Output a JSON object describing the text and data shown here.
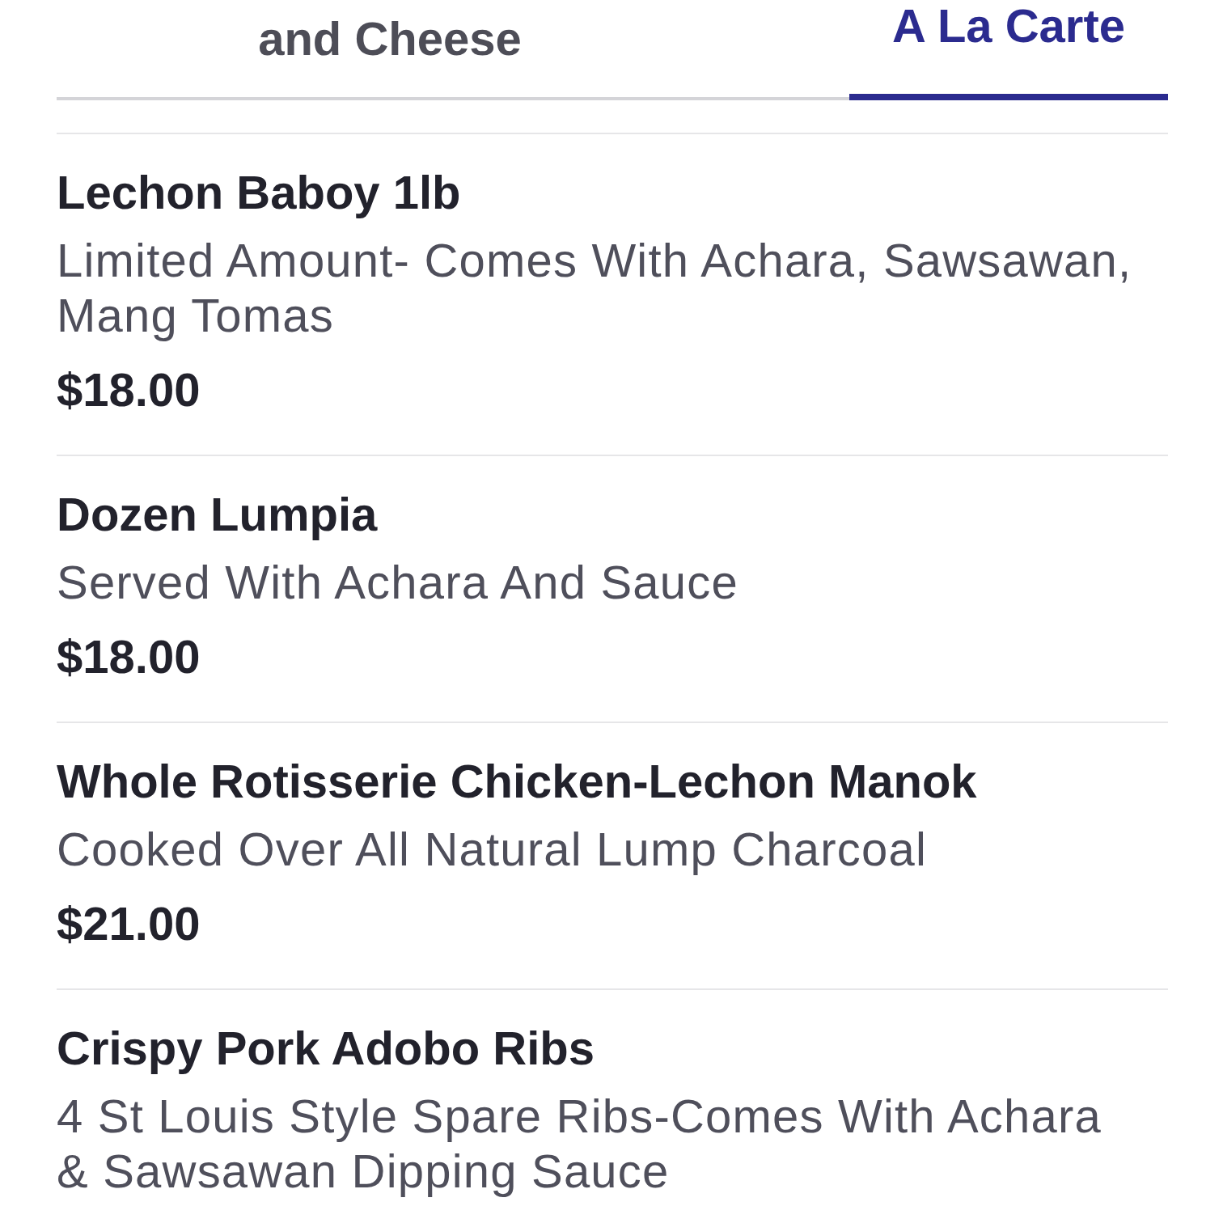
{
  "tabs": [
    {
      "label": "and Cheese",
      "selected": false
    },
    {
      "label": "A La Carte",
      "selected": true
    }
  ],
  "items": [
    {
      "name": "Lechon Baboy 1lb",
      "description": "Limited Amount- Comes With Achara, Sawsawan, Mang Tomas",
      "price": "$18.00"
    },
    {
      "name": "Dozen Lumpia",
      "description": "Served With Achara And Sauce",
      "price": "$18.00"
    },
    {
      "name": "Whole Rotisserie Chicken-Lechon Manok",
      "description": "Cooked Over All Natural Lump Charcoal",
      "price": "$21.00"
    },
    {
      "name": "Crispy Pork Adobo Ribs",
      "description": "4 St Louis Style Spare Ribs-Comes With Achara & Sawsawan Dipping Sauce"
    }
  ]
}
